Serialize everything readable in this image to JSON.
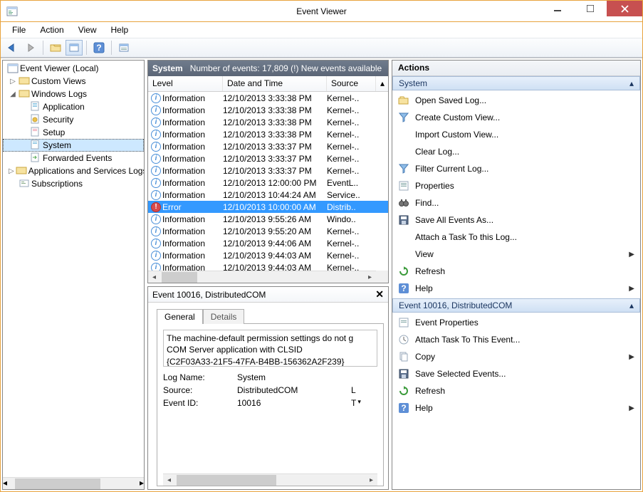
{
  "window": {
    "title": "Event Viewer"
  },
  "menu": {
    "file": "File",
    "action": "Action",
    "view": "View",
    "help": "Help"
  },
  "tree": {
    "root": "Event Viewer (Local)",
    "custom": "Custom Views",
    "winlogs": "Windows Logs",
    "app": "Application",
    "sec": "Security",
    "setup": "Setup",
    "system": "System",
    "fwd": "Forwarded Events",
    "appsvc": "Applications and Services Logs",
    "subs": "Subscriptions"
  },
  "list": {
    "header_name": "System",
    "header_count": "Number of events: 17,809 (!) New events available",
    "col_level": "Level",
    "col_date": "Date and Time",
    "col_source": "Source",
    "rows": [
      {
        "lvl": "Information",
        "dt": "12/10/2013 3:33:38 PM",
        "src": "Kernel-..",
        "t": "info"
      },
      {
        "lvl": "Information",
        "dt": "12/10/2013 3:33:38 PM",
        "src": "Kernel-..",
        "t": "info"
      },
      {
        "lvl": "Information",
        "dt": "12/10/2013 3:33:38 PM",
        "src": "Kernel-..",
        "t": "info"
      },
      {
        "lvl": "Information",
        "dt": "12/10/2013 3:33:38 PM",
        "src": "Kernel-..",
        "t": "info"
      },
      {
        "lvl": "Information",
        "dt": "12/10/2013 3:33:37 PM",
        "src": "Kernel-..",
        "t": "info"
      },
      {
        "lvl": "Information",
        "dt": "12/10/2013 3:33:37 PM",
        "src": "Kernel-..",
        "t": "info"
      },
      {
        "lvl": "Information",
        "dt": "12/10/2013 3:33:37 PM",
        "src": "Kernel-..",
        "t": "info"
      },
      {
        "lvl": "Information",
        "dt": "12/10/2013 12:00:00 PM",
        "src": "EventL..",
        "t": "info"
      },
      {
        "lvl": "Information",
        "dt": "12/10/2013 10:44:24 AM",
        "src": "Service..",
        "t": "info"
      },
      {
        "lvl": "Error",
        "dt": "12/10/2013 10:00:00 AM",
        "src": "Distrib..",
        "t": "err",
        "sel": true
      },
      {
        "lvl": "Information",
        "dt": "12/10/2013 9:55:26 AM",
        "src": "Windo..",
        "t": "info"
      },
      {
        "lvl": "Information",
        "dt": "12/10/2013 9:55:20 AM",
        "src": "Kernel-..",
        "t": "info"
      },
      {
        "lvl": "Information",
        "dt": "12/10/2013 9:44:06 AM",
        "src": "Kernel-..",
        "t": "info"
      },
      {
        "lvl": "Information",
        "dt": "12/10/2013 9:44:03 AM",
        "src": "Kernel-..",
        "t": "info"
      },
      {
        "lvl": "Information",
        "dt": "12/10/2013 9:44:03 AM",
        "src": "Kernel-..",
        "t": "info"
      }
    ]
  },
  "detail": {
    "title": "Event 10016, DistributedCOM",
    "tab_general": "General",
    "tab_details": "Details",
    "msg_l1": "The machine-default permission settings do not g",
    "msg_l2": "COM Server application with CLSID",
    "msg_l3": "{C2F03A33-21F5-47FA-B4BB-156362A2F239}",
    "k_log": "Log Name:",
    "v_log": "System",
    "k_src": "Source:",
    "v_src": "DistributedCOM",
    "v_src_r": "L",
    "k_eid": "Event ID:",
    "v_eid": "10016",
    "v_eid_r": "T"
  },
  "actions": {
    "header": "Actions",
    "group1": "System",
    "open": "Open Saved Log...",
    "create": "Create Custom View...",
    "import": "Import Custom View...",
    "clear": "Clear Log...",
    "filter": "Filter Current Log...",
    "props": "Properties",
    "find": "Find...",
    "save": "Save All Events As...",
    "attach": "Attach a Task To this Log...",
    "view": "View",
    "refresh": "Refresh",
    "help": "Help",
    "group2": "Event 10016, DistributedCOM",
    "evprops": "Event Properties",
    "evattach": "Attach Task To This Event...",
    "copy": "Copy",
    "savesel": "Save Selected Events...",
    "refresh2": "Refresh",
    "help2": "Help"
  }
}
